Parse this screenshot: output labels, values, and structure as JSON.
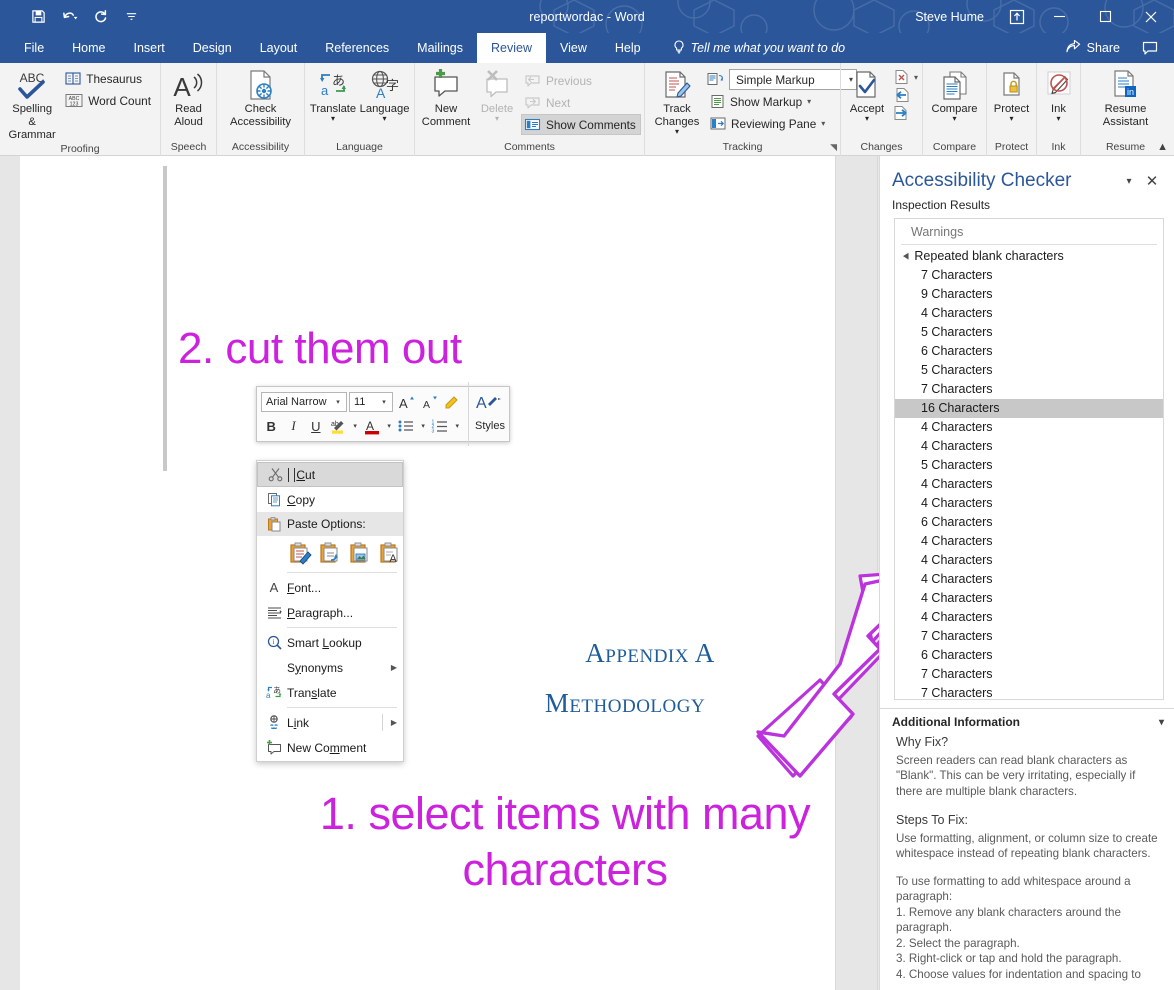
{
  "titlebar": {
    "doc_title": "reportwordac  -  Word",
    "account_name": "Steve Hume",
    "qat": [
      {
        "name": "save-icon",
        "label": "Save"
      },
      {
        "name": "undo-icon",
        "label": "Undo"
      },
      {
        "name": "redo-icon",
        "label": "Redo"
      },
      {
        "name": "customize-qat-icon",
        "label": "Customize Quick Access Toolbar"
      }
    ],
    "window_controls": {
      "ribbon_display_options": "Ribbon Display Options",
      "minimize": "—",
      "maximize": "☐",
      "close": "✕"
    }
  },
  "tabs": {
    "items": [
      {
        "label": "File",
        "active": false
      },
      {
        "label": "Home",
        "active": false
      },
      {
        "label": "Insert",
        "active": false
      },
      {
        "label": "Design",
        "active": false
      },
      {
        "label": "Layout",
        "active": false
      },
      {
        "label": "References",
        "active": false
      },
      {
        "label": "Mailings",
        "active": false
      },
      {
        "label": "Review",
        "active": true
      },
      {
        "label": "View",
        "active": false
      },
      {
        "label": "Help",
        "active": false
      }
    ],
    "tellme": "Tell me what you want to do",
    "share_label": "Share"
  },
  "ribbon": {
    "groups": [
      {
        "label": "Proofing",
        "big": [
          {
            "label": "Spelling &\nGrammar",
            "icon": "abc-check-icon"
          }
        ],
        "small": [
          {
            "label": "Thesaurus",
            "icon": "thesaurus-icon"
          },
          {
            "label": "Word Count",
            "icon": "word-count-icon"
          }
        ]
      },
      {
        "label": "Speech",
        "big": [
          {
            "label": "Read\nAloud",
            "icon": "read-aloud-icon"
          }
        ],
        "small": []
      },
      {
        "label": "Accessibility",
        "big": [
          {
            "label": "Check\nAccessibility",
            "icon": "check-accessibility-icon"
          }
        ],
        "small": []
      },
      {
        "label": "Language",
        "big": [
          {
            "label": "Translate",
            "icon": "translate-icon",
            "caret": true
          },
          {
            "label": "Language",
            "icon": "language-icon",
            "caret": true
          }
        ],
        "small": []
      },
      {
        "label": "Comments",
        "big": [
          {
            "label": "New\nComment",
            "icon": "new-comment-icon"
          },
          {
            "label": "Delete",
            "icon": "delete-comment-icon",
            "caret": true,
            "disabled": true
          }
        ],
        "small": [
          {
            "label": "Previous",
            "icon": "previous-comment-icon",
            "disabled": true
          },
          {
            "label": "Next",
            "icon": "next-comment-icon",
            "disabled": true
          },
          {
            "label": "Show Comments",
            "icon": "show-comments-icon",
            "pressed": true
          }
        ]
      },
      {
        "label": "Tracking",
        "dialog_launcher": true,
        "big": [
          {
            "label": "Track\nChanges",
            "icon": "track-changes-icon",
            "caret": true
          }
        ],
        "small": [
          {
            "label": "Simple Markup",
            "icon": "markup-mode-icon",
            "combo": true
          },
          {
            "label": "Show Markup",
            "icon": "show-markup-icon",
            "caret": true
          },
          {
            "label": "Reviewing Pane",
            "icon": "reviewing-pane-icon",
            "caret": true
          }
        ]
      },
      {
        "label": "Changes",
        "big": [
          {
            "label": "Accept",
            "icon": "accept-change-icon",
            "caret": true
          }
        ],
        "small": [
          {
            "label": "",
            "icon": "reject-change-icon",
            "caret": true
          },
          {
            "label": "",
            "icon": "previous-change-icon"
          },
          {
            "label": "",
            "icon": "next-change-icon"
          }
        ]
      },
      {
        "label": "Compare",
        "big": [
          {
            "label": "Compare",
            "icon": "compare-icon",
            "caret": true
          }
        ],
        "small": []
      },
      {
        "label": "Protect",
        "big": [
          {
            "label": "Protect",
            "icon": "protect-icon",
            "caret": true
          }
        ],
        "small": []
      },
      {
        "label": "Ink",
        "big": [
          {
            "label": "Ink",
            "icon": "ink-icon",
            "caret": true
          }
        ],
        "small": []
      },
      {
        "label": "Resume",
        "big": [
          {
            "label": "Resume\nAssistant",
            "icon": "resume-assistant-icon"
          }
        ],
        "small": []
      }
    ],
    "collapse_label": "Collapse the Ribbon"
  },
  "minitoolbar": {
    "font_name": "Arial Narrow",
    "font_size": "11",
    "buttons": [
      {
        "name": "grow-font-button",
        "label": "A"
      },
      {
        "name": "shrink-font-button",
        "label": "A"
      },
      {
        "name": "format-painter-button",
        "label": "✒"
      },
      {
        "name": "styles-button",
        "label": "Styles"
      },
      {
        "name": "bold-button",
        "label": "B"
      },
      {
        "name": "italic-button",
        "label": "I"
      },
      {
        "name": "underline-button",
        "label": "U"
      },
      {
        "name": "highlight-button",
        "label": "ab"
      },
      {
        "name": "font-color-button",
        "label": "A"
      },
      {
        "name": "bullets-button",
        "label": "•—"
      },
      {
        "name": "numbering-button",
        "label": "1—"
      }
    ],
    "styles_label": "Styles"
  },
  "contextmenu": {
    "items": [
      {
        "label": "Cut",
        "icon": "scissors-icon",
        "highlighted": true,
        "underline_index": 0
      },
      {
        "label": "Copy",
        "icon": "copy-icon",
        "underline_index": 0
      },
      {
        "label": "Paste Options:",
        "icon": "paste-icon",
        "header": true
      }
    ],
    "paste_options": [
      {
        "name": "paste-keep-source-formatting-icon"
      },
      {
        "name": "paste-merge-formatting-icon"
      },
      {
        "name": "paste-picture-icon"
      },
      {
        "name": "paste-keep-text-only-icon"
      }
    ],
    "items2": [
      {
        "label": "Font...",
        "icon": "font-icon"
      },
      {
        "label": "Paragraph...",
        "icon": "paragraph-icon"
      },
      {
        "label": "Smart Lookup",
        "icon": "smart-lookup-icon"
      },
      {
        "label": "Synonyms",
        "icon": "",
        "submenu": true
      },
      {
        "label": "Translate",
        "icon": "translate-small-icon"
      },
      {
        "label": "Link",
        "icon": "link-icon",
        "submenu": true
      },
      {
        "label": "New Comment",
        "icon": "new-comment-small-icon"
      }
    ]
  },
  "document": {
    "annotation_top": "2. cut them out",
    "annotation_bottom": "1. select items with many characters",
    "heading1": "Appendix A",
    "heading2": "Methodology",
    "annotation_color": "#cc22dd",
    "heading_color": "#1f5c99",
    "arrow_name": "arrow-annotation"
  },
  "pane": {
    "title": "Accessibility Checker",
    "subtitle": "Inspection Results",
    "results_header": "Warnings",
    "group_label": "Repeated blank characters",
    "items": [
      {
        "label": "7 Characters",
        "selected": false
      },
      {
        "label": "9 Characters",
        "selected": false
      },
      {
        "label": "4 Characters",
        "selected": false
      },
      {
        "label": "5 Characters",
        "selected": false
      },
      {
        "label": "6 Characters",
        "selected": false
      },
      {
        "label": "5 Characters",
        "selected": false
      },
      {
        "label": "7 Characters",
        "selected": false
      },
      {
        "label": "16 Characters",
        "selected": true
      },
      {
        "label": "4 Characters",
        "selected": false
      },
      {
        "label": "4 Characters",
        "selected": false
      },
      {
        "label": "5 Characters",
        "selected": false
      },
      {
        "label": "4 Characters",
        "selected": false
      },
      {
        "label": "4 Characters",
        "selected": false
      },
      {
        "label": "6 Characters",
        "selected": false
      },
      {
        "label": "4 Characters",
        "selected": false
      },
      {
        "label": "4 Characters",
        "selected": false
      },
      {
        "label": "4 Characters",
        "selected": false
      },
      {
        "label": "4 Characters",
        "selected": false
      },
      {
        "label": "4 Characters",
        "selected": false
      },
      {
        "label": "7 Characters",
        "selected": false
      },
      {
        "label": "6 Characters",
        "selected": false
      },
      {
        "label": "7 Characters",
        "selected": false
      },
      {
        "label": "7 Characters",
        "selected": false
      }
    ],
    "additional": {
      "heading": "Additional Information",
      "why_fix_heading": "Why Fix?",
      "why_fix_body": "Screen readers can read blank characters as \"Blank\". This can be very irritating, especially if there are multiple blank characters.",
      "steps_heading": "Steps To Fix:",
      "steps_body": " Use formatting, alignment, or column size to create whitespace instead of repeating blank characters.",
      "steps_body2": "To use formatting to add whitespace around a paragraph:",
      "step1": "1. Remove any blank characters around the paragraph.",
      "step2": "2. Select the paragraph.",
      "step3": "3. Right-click or tap and hold the paragraph.",
      "step4": "4. Choose values for indentation and spacing to"
    }
  },
  "colors": {
    "word_blue": "#2b579a",
    "ribbon_bg": "#f3f3f3",
    "annotation_magenta": "#cc22dd",
    "heading_blue": "#1f5c99",
    "selection_gray": "#c8c8c8"
  }
}
